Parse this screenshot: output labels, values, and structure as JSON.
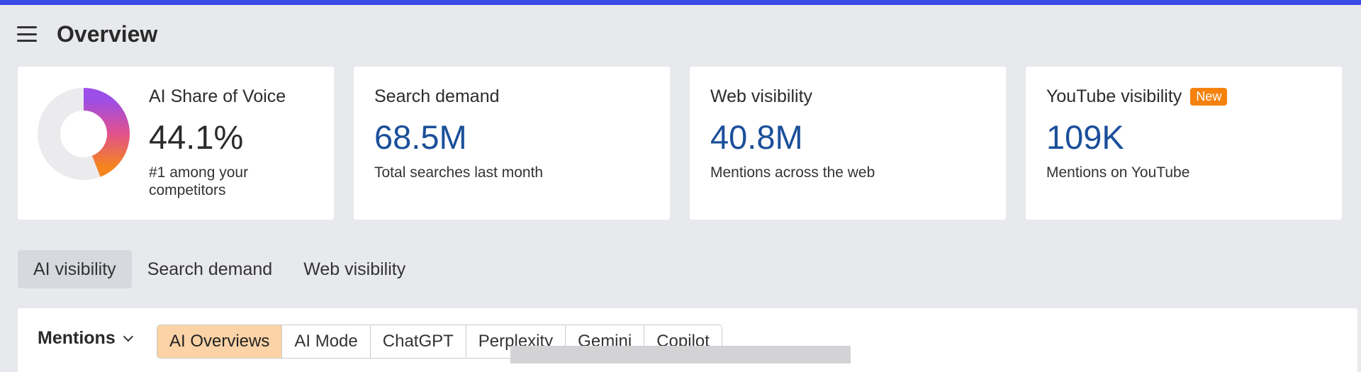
{
  "header": {
    "title": "Overview"
  },
  "cards": [
    {
      "title": "AI Share of Voice",
      "value": "44.1%",
      "sub_line1": "#1 among your",
      "sub_line2": "competitors",
      "share_percent": 44.1
    },
    {
      "title": "Search demand",
      "value": "68.5M",
      "sub": "Total searches last month"
    },
    {
      "title": "Web visibility",
      "value": "40.8M",
      "sub": "Mentions across the web"
    },
    {
      "title": "YouTube visibility",
      "badge": "New",
      "value": "109K",
      "sub": "Mentions on YouTube"
    }
  ],
  "tabs": [
    {
      "label": "AI visibility",
      "active": true
    },
    {
      "label": "Search demand",
      "active": false
    },
    {
      "label": "Web visibility",
      "active": false
    }
  ],
  "panel": {
    "dropdown_label": "Mentions",
    "segments": [
      {
        "label": "AI Overviews",
        "active": true
      },
      {
        "label": "AI Mode",
        "active": false
      },
      {
        "label": "ChatGPT",
        "active": false
      },
      {
        "label": "Perplexity",
        "active": false
      },
      {
        "label": "Gemini",
        "active": false
      },
      {
        "label": "Copilot",
        "active": false
      }
    ]
  },
  "icons": {
    "menu": "hamburger-icon",
    "dropdown": "chevron-down-icon"
  },
  "colors": {
    "accent_bar": "#3b4be8",
    "value_blue": "#1b4f9a",
    "badge": "#f5820c",
    "segment_active": "#fbd3a6"
  }
}
